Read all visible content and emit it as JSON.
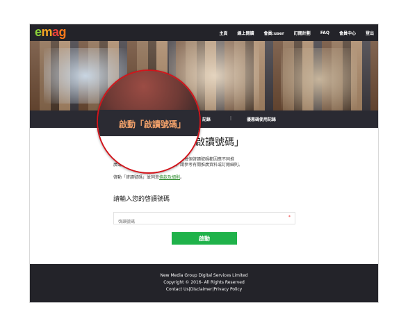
{
  "logo": {
    "e": "e",
    "m": "m",
    "a": "a",
    "g": "g"
  },
  "nav": {
    "items": [
      "主頁",
      "線上閱讀",
      "會員:user",
      "訂閱計劃",
      "FAQ",
      "會員中心",
      "登出"
    ]
  },
  "tabs": {
    "left": "記錄",
    "separator": "|",
    "right": "優惠碼使用記錄"
  },
  "main": {
    "title": "啟讀號碼」",
    "desc_line1": "每　　　　　　　戶只可啟動一次，而每個啓讀號碼都因應不同推",
    "desc_line2": "廣或計　　　　　　用條款及限制，請參考有關推廣資料或訂閱細則。",
    "agree_prefix": "啓動「啓讀號碼」並同意",
    "agree_link": "條款及細則",
    "agree_suffix": "。",
    "subhead": "請輸入您的啓讀號碼",
    "input_placeholder": "啓讀號碼",
    "required_mark": "*",
    "submit_label": "啟動"
  },
  "footer": {
    "line1": "New Media Group Digital Services Limited",
    "line2": "Copyright © 2016- All Rights Reserved",
    "line3": "Contact Us|Disclaimer|Privacy Policy"
  },
  "magnifier": {
    "label": "啟動「啟讀號碼」"
  },
  "colors": {
    "accent_green": "#1fb24a",
    "nav_bg": "#232329",
    "magnifier_border": "#d2141b"
  }
}
